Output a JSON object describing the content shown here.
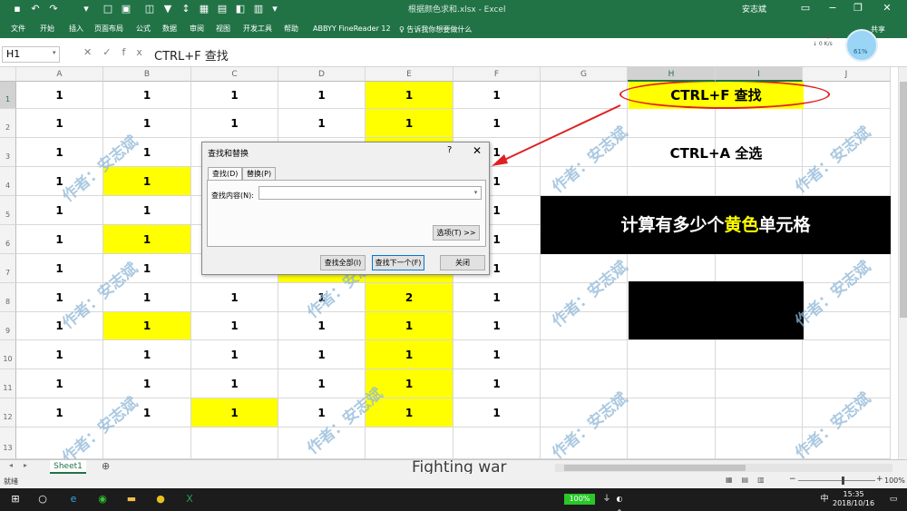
{
  "window": {
    "title": "根据颜色求和.xlsx - Excel",
    "user": "安志斌",
    "share": "共享"
  },
  "ribbon": {
    "tabs": [
      "文件",
      "开始",
      "插入",
      "页面布局",
      "公式",
      "数据",
      "审阅",
      "视图",
      "开发工具",
      "帮助",
      "ABBYY FineReader 12"
    ],
    "tell_me": "告诉我你想要做什么"
  },
  "formula_bar": {
    "name_box": "H1",
    "content": "CTRL+F  查找"
  },
  "speed_widget": {
    "up": "↑ 2 K/s",
    "down": "↓ 0 K/s",
    "percent": "61%"
  },
  "columns": [
    "A",
    "B",
    "C",
    "D",
    "E",
    "F",
    "G",
    "H",
    "I",
    "J"
  ],
  "rows": [
    "1",
    "2",
    "3",
    "4",
    "5",
    "6",
    "7",
    "8",
    "9",
    "10",
    "11",
    "12",
    "13"
  ],
  "cells": [
    [
      "1",
      "1",
      "1",
      "1",
      "1",
      "1"
    ],
    [
      "1",
      "1",
      "1",
      "1",
      "1",
      "1"
    ],
    [
      "1",
      "1",
      "",
      "",
      "",
      "1"
    ],
    [
      "1",
      "1",
      "",
      "",
      "",
      "1"
    ],
    [
      "1",
      "1",
      "",
      "",
      "",
      "1"
    ],
    [
      "1",
      "1",
      "",
      "",
      "",
      "1"
    ],
    [
      "1",
      "1",
      "",
      "",
      "",
      "1"
    ],
    [
      "1",
      "1",
      "1",
      "1",
      "2",
      "1"
    ],
    [
      "1",
      "1",
      "1",
      "1",
      "1",
      "1"
    ],
    [
      "1",
      "1",
      "1",
      "1",
      "1",
      "1"
    ],
    [
      "1",
      "1",
      "1",
      "1",
      "1",
      "1"
    ],
    [
      "1",
      "1",
      "1",
      "1",
      "1",
      "1"
    ]
  ],
  "yellow_cells": [
    [
      0,
      4
    ],
    [
      1,
      4
    ],
    [
      3,
      1
    ],
    [
      5,
      1
    ],
    [
      7,
      4
    ],
    [
      8,
      1
    ],
    [
      8,
      4
    ],
    [
      9,
      4
    ],
    [
      10,
      4
    ],
    [
      11,
      2
    ],
    [
      11,
      4
    ],
    [
      2,
      4
    ],
    [
      3,
      4
    ],
    [
      4,
      4
    ],
    [
      5,
      4
    ],
    [
      6,
      4
    ],
    [
      6,
      3
    ]
  ],
  "side": {
    "ctrl_f": "CTRL+F  查找",
    "ctrl_a": "CTRL+A 全选",
    "banner_pre": "计算有多少个",
    "banner_hl": "黄色",
    "banner_post": "单元格"
  },
  "watermark": "作者：安志斌",
  "dialog": {
    "title": "查找和替换",
    "help": "?",
    "close": "✕",
    "tab_find": "查找(D)",
    "tab_replace": "替换(P)",
    "find_label": "查找内容(N):",
    "find_value": "",
    "options": "选项(T) >>",
    "find_all": "查找全部(I)",
    "find_next": "查找下一个(F)",
    "close_btn": "关闭"
  },
  "sheet": {
    "tab": "Sheet1",
    "add": "⊕"
  },
  "subtitle": "Fighting war",
  "status": {
    "mode": "就绪",
    "zoom": "100%"
  },
  "taskbar": {
    "battery": "100%",
    "time": "15:35",
    "date": "2018/10/16",
    "ime": "中"
  }
}
